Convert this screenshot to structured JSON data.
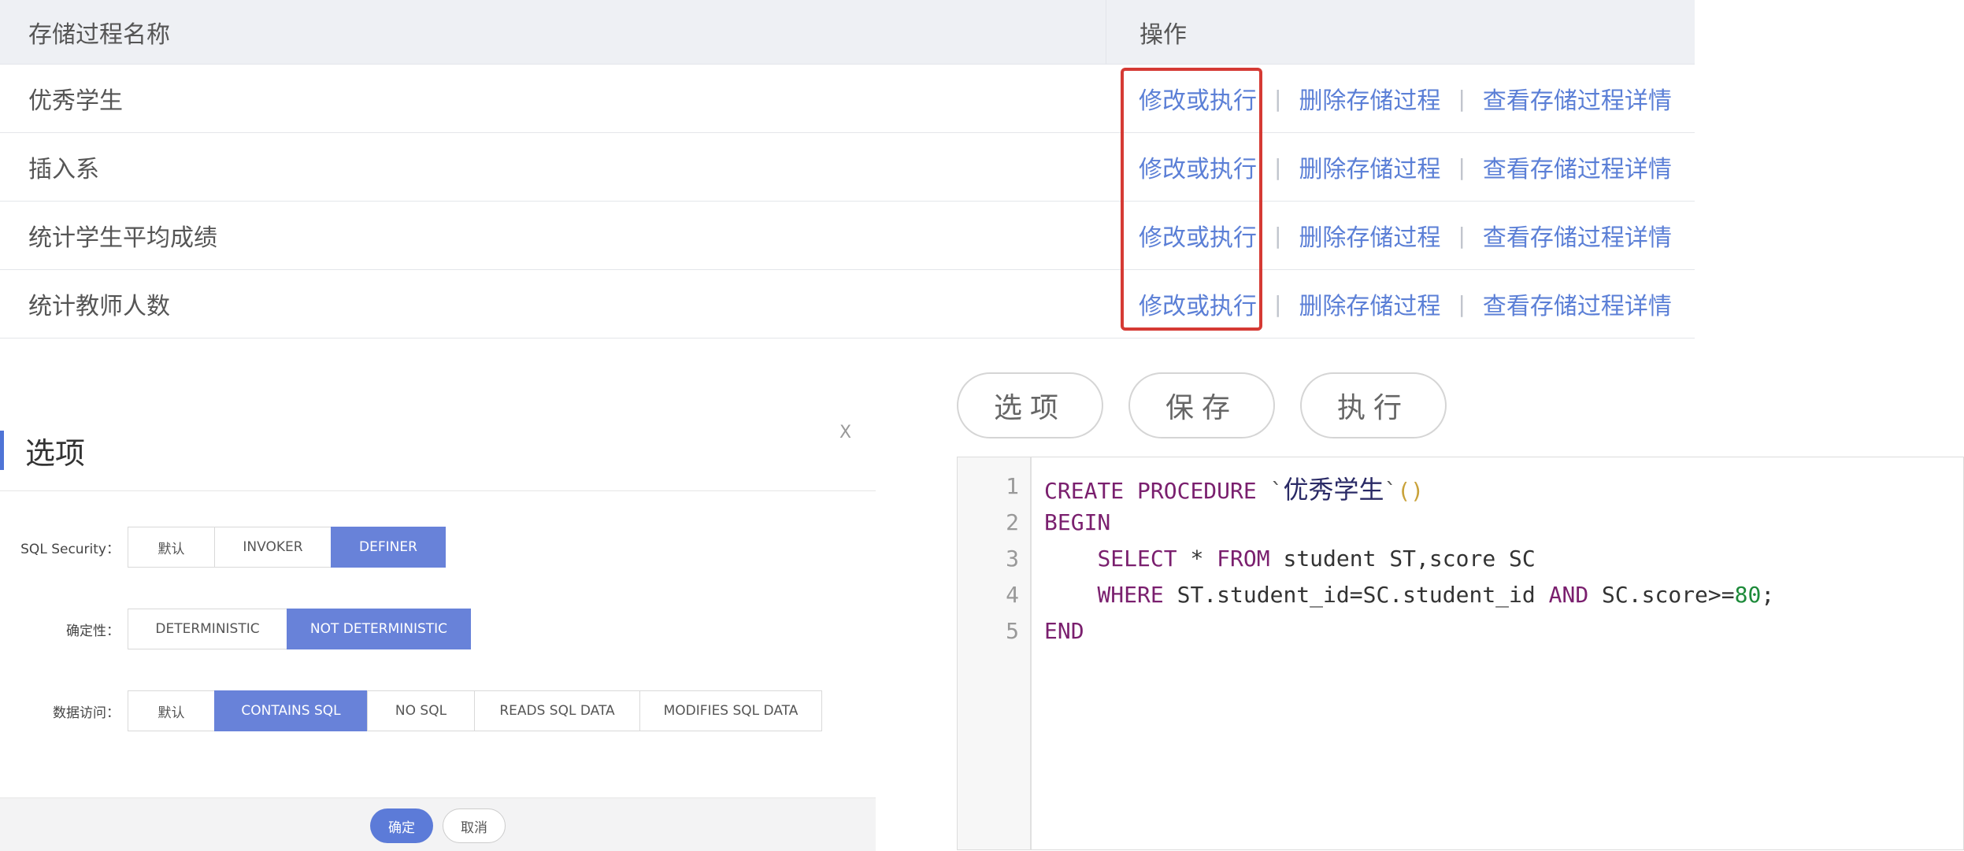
{
  "table": {
    "headers": {
      "name": "存储过程名称",
      "ops": "操作"
    },
    "rows": [
      {
        "name": "优秀学生"
      },
      {
        "name": "插入系"
      },
      {
        "name": "统计学生平均成绩"
      },
      {
        "name": "统计教师人数"
      }
    ],
    "actions": {
      "edit": "修改或执行",
      "delete": "删除存储过程",
      "detail": "查看存储过程详情",
      "separator": "|"
    }
  },
  "dialog": {
    "title": "选项",
    "close": "X",
    "security": {
      "label": "SQL Security：",
      "options": [
        "默认",
        "INVOKER",
        "DEFINER"
      ],
      "selected": "DEFINER"
    },
    "deterministic": {
      "label": "确定性：",
      "options": [
        "DETERMINISTIC",
        "NOT DETERMINISTIC"
      ],
      "selected": "NOT DETERMINISTIC"
    },
    "data_access": {
      "label": "数据访问：",
      "options": [
        "默认",
        "CONTAINS SQL",
        "NO SQL",
        "READS SQL DATA",
        "MODIFIES SQL DATA"
      ],
      "selected": "CONTAINS SQL"
    },
    "ok": "确定",
    "cancel": "取消"
  },
  "toolbar": {
    "options": "选项",
    "save": "保存",
    "run": "执行"
  },
  "editor": {
    "line_numbers": [
      "1",
      "2",
      "3",
      "4",
      "5"
    ],
    "lines": [
      {
        "kw1": "CREATE",
        "kw2": "PROCEDURE",
        "quote_open": "`",
        "name": "优秀学生",
        "quote_close": "`",
        "parens": "()"
      },
      {
        "kw": "BEGIN"
      },
      {
        "kw1": "SELECT",
        "mid": " * ",
        "kw2": "FROM",
        "rest": " student ST,score SC"
      },
      {
        "kw1": "WHERE",
        "mid": " ST.student_id=SC.student_id ",
        "kw2": "AND",
        "rest": " SC.score>=",
        "num": "80",
        "end": ";"
      },
      {
        "kw": "END"
      }
    ]
  },
  "colors": {
    "accent": "#6882d9",
    "link": "#5b7fd6",
    "highlight": "#d53a34",
    "keyword": "#7a1f6e",
    "number": "#1d8a3a"
  }
}
